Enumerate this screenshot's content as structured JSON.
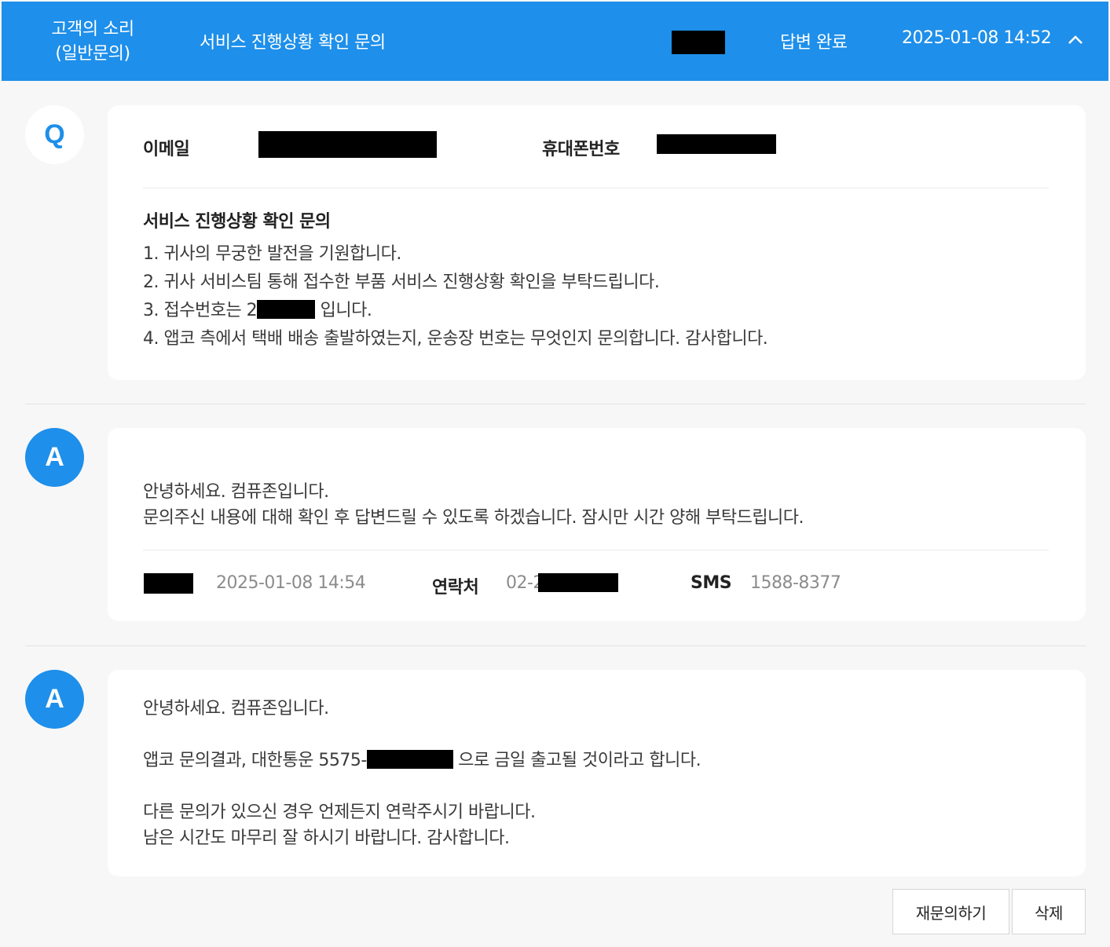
{
  "header": {
    "category_line1": "고객의 소리",
    "category_line2": "(일반문의)",
    "title": "서비스 진행상황 확인 문의",
    "status": "답변 완료",
    "datetime": "2025-01-08   14:52",
    "accent_color": "#1e8fea",
    "collapse_icon": "chevron-up-icon"
  },
  "question": {
    "badge": "Q",
    "email_label": "이메일",
    "phone_label": "휴대폰번호",
    "subject": "서비스 진행상황 확인 문의",
    "lines": [
      "1. 귀사의 무궁한 발전을 기원합니다.",
      "2. 귀사 서비스팀 통해 접수한 부품 서비스 진행상황 확인을 부탁드립니다.",
      "4. 앱코 측에서 택배 배송 출발하였는지, 운송장 번호는 무엇인지 문의합니다. 감사합니다."
    ],
    "line3_prefix": "3. 접수번호는 2",
    "line3_suffix": " 입니다."
  },
  "answer1": {
    "badge": "A",
    "line1": "안녕하세요. 컴퓨존입니다.",
    "line2": "문의주신 내용에 대해 확인 후 답변드릴 수 있도록 하겠습니다. 잠시만 시간 양해 부탁드립니다.",
    "datetime": "2025-01-08  14:54",
    "contact_label": "연락처",
    "contact_prefix": "02-2",
    "sms_label": "SMS",
    "sms_number": "1588-8377"
  },
  "answer2": {
    "badge": "A",
    "line1": "안녕하세요. 컴퓨존입니다.",
    "line2_prefix": "앱코 문의결과, 대한통운 5575-",
    "line2_suffix": " 으로 금일 출고될 것이라고 합니다.",
    "line3": "다른 문의가 있으신 경우 언제든지 연락주시기 바랍니다.",
    "line4": "남은 시간도 마무리 잘 하시기 바랍니다. 감사합니다."
  },
  "buttons": {
    "reinquire": "재문의하기",
    "delete": "삭제"
  }
}
